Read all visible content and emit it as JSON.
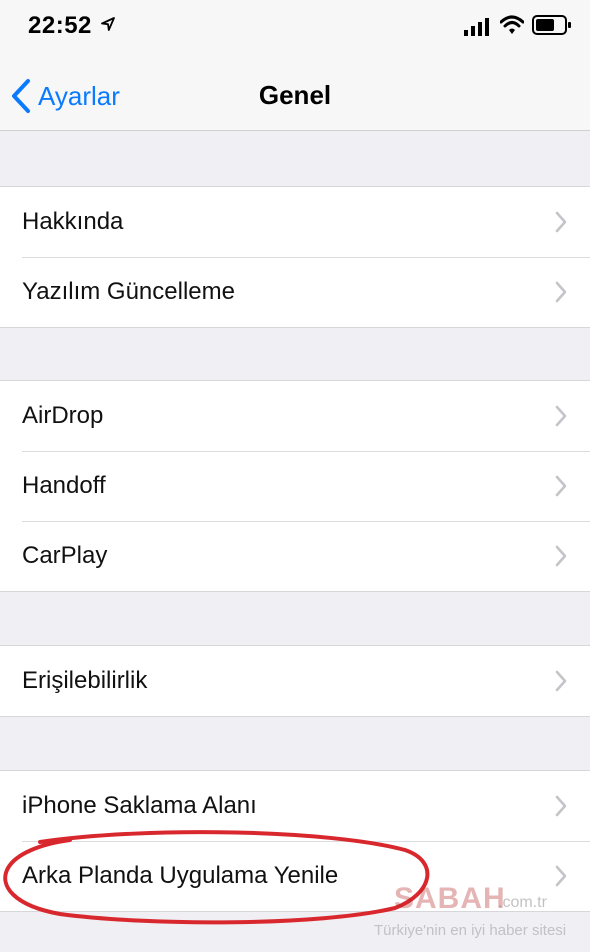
{
  "status_bar": {
    "time": "22:52",
    "icons": [
      "location-arrow-icon",
      "cellular-signal-icon",
      "wifi-icon",
      "battery-icon"
    ]
  },
  "nav": {
    "back_label": "Ayarlar",
    "title": "Genel",
    "accent_color": "#0a7aff"
  },
  "groups": [
    {
      "items": [
        {
          "label": "Hakkında"
        },
        {
          "label": "Yazılım Güncelleme"
        }
      ]
    },
    {
      "items": [
        {
          "label": "AirDrop"
        },
        {
          "label": "Handoff"
        },
        {
          "label": "CarPlay"
        }
      ]
    },
    {
      "items": [
        {
          "label": "Erişilebilirlik"
        }
      ]
    },
    {
      "items": [
        {
          "label": "iPhone Saklama Alanı"
        },
        {
          "label": "Arka Planda Uygulama Yenile"
        }
      ]
    }
  ],
  "annotation": {
    "highlight_color": "#d8282e"
  },
  "watermark": {
    "logo": "SABAH",
    "domain": ".com.tr",
    "tagline": "Türkiye'nin en iyi haber sitesi"
  }
}
